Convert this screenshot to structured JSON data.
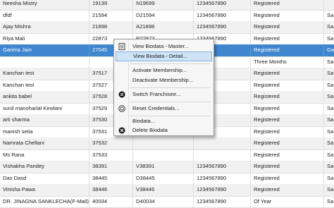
{
  "grid": {
    "rows": [
      {
        "name": "Neesha Mistry",
        "id": "19139",
        "code": "N19699",
        "phone": "1234567890",
        "status": "Registered",
        "extra": ""
      },
      {
        "name": "dfdf",
        "id": "21594",
        "code": "D21594",
        "phone": "1234567890",
        "status": "Registered",
        "extra": "Sa"
      },
      {
        "name": "Ajay Mishra",
        "id": "21898",
        "code": "A21898",
        "phone": "1234567890",
        "status": "Registered",
        "extra": "Sa"
      },
      {
        "name": "Riya Mali",
        "id": "22873",
        "code": "R22873",
        "phone": "1234567890",
        "status": "Registered",
        "extra": "Sa"
      },
      {
        "name": "Garima Jain",
        "id": "27045",
        "code": "",
        "phone": "",
        "status": "Registered",
        "extra": "Ga"
      },
      {
        "name": "",
        "id": "",
        "code": "",
        "phone": "",
        "status": "Three Months",
        "extra": "Sa"
      },
      {
        "name": "Kanchan test",
        "id": "37517",
        "code": "",
        "phone": "",
        "status": "Registered",
        "extra": "Sa"
      },
      {
        "name": "Kanchan test",
        "id": "37527",
        "code": "",
        "phone": "",
        "status": "Registered",
        "extra": "Sa"
      },
      {
        "name": "ankita babel",
        "id": "37528",
        "code": "",
        "phone": "",
        "status": "Registered",
        "extra": "Sa"
      },
      {
        "name": "sunil manoharlal Kewlani",
        "id": "37529",
        "code": "",
        "phone": "",
        "status": "Registered",
        "extra": "Sa"
      },
      {
        "name": "arti sharma",
        "id": "37530",
        "code": "",
        "phone": "",
        "status": "Registered",
        "extra": "Sa"
      },
      {
        "name": "manish setia",
        "id": "37531",
        "code": "",
        "phone": "",
        "status": "Registered",
        "extra": "Sa"
      },
      {
        "name": "Namrata Chellani",
        "id": "37532",
        "code": "",
        "phone": "",
        "status": "Registered",
        "extra": "Sa"
      },
      {
        "name": "Ms Rana",
        "id": "37533",
        "code": "",
        "phone": "",
        "status": "Registered",
        "extra": "Sa"
      },
      {
        "name": "Vishakha Pandey",
        "id": "38391",
        "code": "V38391",
        "phone": "1234567890",
        "status": "Registered",
        "extra": "Sa"
      },
      {
        "name": "Das Dasd",
        "id": "38445",
        "code": "D38445",
        "phone": "1234567890",
        "status": "Registered",
        "extra": "Sa"
      },
      {
        "name": "Vinisha Pawa",
        "id": "38446",
        "code": "V38446",
        "phone": "1234567890",
        "status": "Registered",
        "extra": "Sa"
      },
      {
        "name": "DR. JINAGNA SANKLECHA(F-Mail)",
        "id": "40034",
        "code": "D40034",
        "phone": "1234567890",
        "status": "Of Year",
        "extra": "Sa"
      }
    ]
  },
  "menu": {
    "items": [
      {
        "label": "View Biodata - Master...",
        "icon": "document-icon"
      },
      {
        "label": "View Biodata - Detail...",
        "icon": ""
      },
      {
        "label": "Activate Membership...",
        "icon": ""
      },
      {
        "label": "Deactivate Membership...",
        "icon": ""
      },
      {
        "label": "Switch Franchisee...",
        "icon": "switch-icon"
      },
      {
        "label": "Reset Credentials...",
        "icon": "reset-icon"
      },
      {
        "label": "Biodata...",
        "icon": ""
      },
      {
        "label": "Delete Biodata",
        "icon": "delete-icon"
      }
    ]
  }
}
